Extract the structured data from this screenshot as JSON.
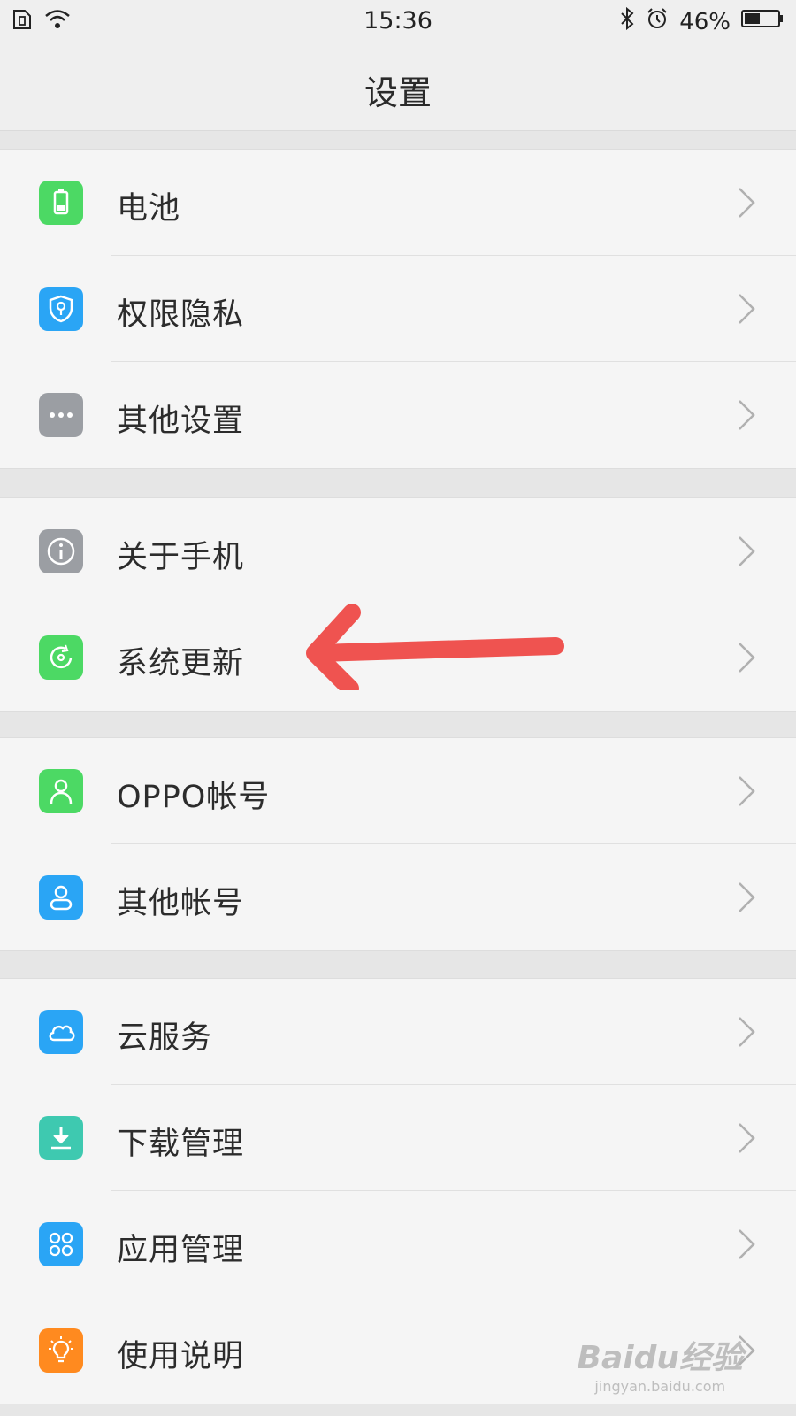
{
  "status_bar": {
    "time": "15:36",
    "battery": "46%"
  },
  "nav": {
    "title": "设置"
  },
  "groups": [
    {
      "items": [
        {
          "label": "电池",
          "icon": "battery-icon",
          "color": "#4cd964"
        },
        {
          "label": "权限隐私",
          "icon": "shield-icon",
          "color": "#2aa5f5"
        },
        {
          "label": "其他设置",
          "icon": "more-icon",
          "color": "#9b9ea3"
        }
      ]
    },
    {
      "items": [
        {
          "label": "关于手机",
          "icon": "info-icon",
          "color": "#9b9ea3"
        },
        {
          "label": "系统更新",
          "icon": "update-icon",
          "color": "#4cd964"
        }
      ]
    },
    {
      "items": [
        {
          "label": "OPPO帐号",
          "icon": "user-icon",
          "color": "#4cd964"
        },
        {
          "label": "其他帐号",
          "icon": "account-icon",
          "color": "#2aa5f5"
        }
      ]
    },
    {
      "items": [
        {
          "label": "云服务",
          "icon": "cloud-icon",
          "color": "#2aa5f5"
        },
        {
          "label": "下载管理",
          "icon": "download-icon",
          "color": "#3ec9b0"
        },
        {
          "label": "应用管理",
          "icon": "apps-icon",
          "color": "#2aa5f5"
        },
        {
          "label": "使用说明",
          "icon": "bulb-icon",
          "color": "#ff8a1f"
        }
      ]
    }
  ],
  "annotation": {
    "arrow_color": "#ef5350"
  },
  "watermark": {
    "main": "Baidu经验",
    "sub": "jingyan.baidu.com"
  }
}
